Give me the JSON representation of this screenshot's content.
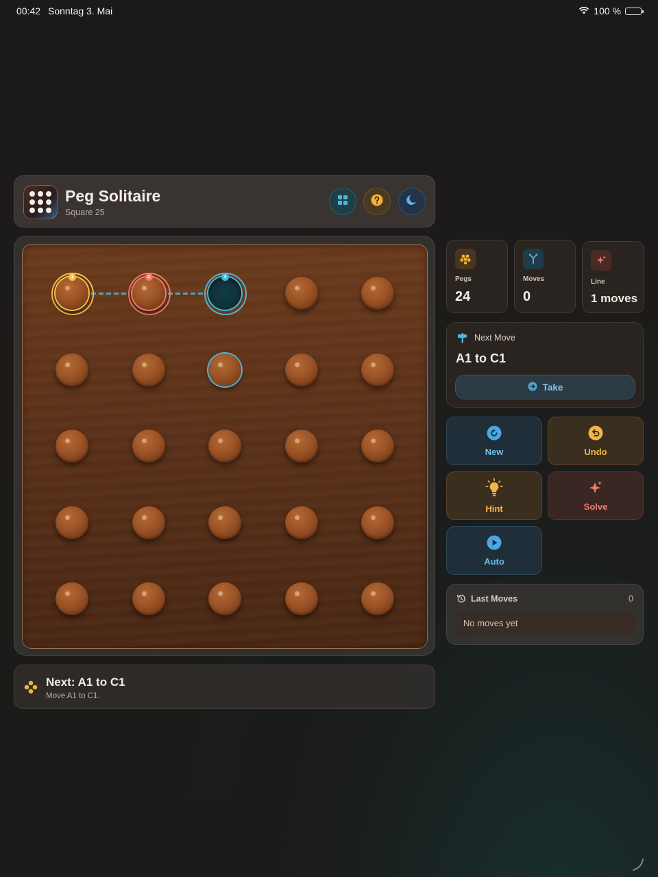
{
  "status": {
    "time": "00:42",
    "date": "Sonntag 3. Mai",
    "battery": "100 %"
  },
  "header": {
    "title": "Peg Solitaire",
    "subtitle": "Square 25",
    "buttons": [
      "grid-layout-icon",
      "help-icon",
      "moon-icon"
    ],
    "colors": {
      "grid": "#49b7d6",
      "help": "#f3b234",
      "moon": "#5fb0f0"
    }
  },
  "board": {
    "rows": 5,
    "cols": 5,
    "empty": [
      "C1"
    ],
    "highlight": {
      "A1": {
        "ring": "yellow",
        "badge": "1"
      },
      "B1": {
        "ring": "red",
        "badge": "2"
      },
      "C1": {
        "ring": "blue",
        "badge": "3"
      },
      "C2": {
        "ring": "blue"
      }
    },
    "colors": {
      "wood": "#5a311a",
      "peg": "#9b5327",
      "yellow": "#f3c24a",
      "red": "#ef7b6a",
      "blue": "#49b7d6"
    }
  },
  "banner": {
    "title": "Next: A1 to C1",
    "desc": "Move A1 to C1."
  },
  "stats": {
    "pegs": {
      "label": "Pegs",
      "value": "24"
    },
    "moves": {
      "label": "Moves",
      "value": "0"
    },
    "line": {
      "label": "Line",
      "value": "1 moves"
    }
  },
  "next_move": {
    "label": "Next Move",
    "value": "A1 to C1",
    "take_label": "Take"
  },
  "actions": {
    "new": "New",
    "undo": "Undo",
    "hint": "Hint",
    "solve": "Solve",
    "auto": "Auto"
  },
  "last_moves": {
    "title": "Last Moves",
    "count": "0",
    "empty": "No moves yet"
  }
}
